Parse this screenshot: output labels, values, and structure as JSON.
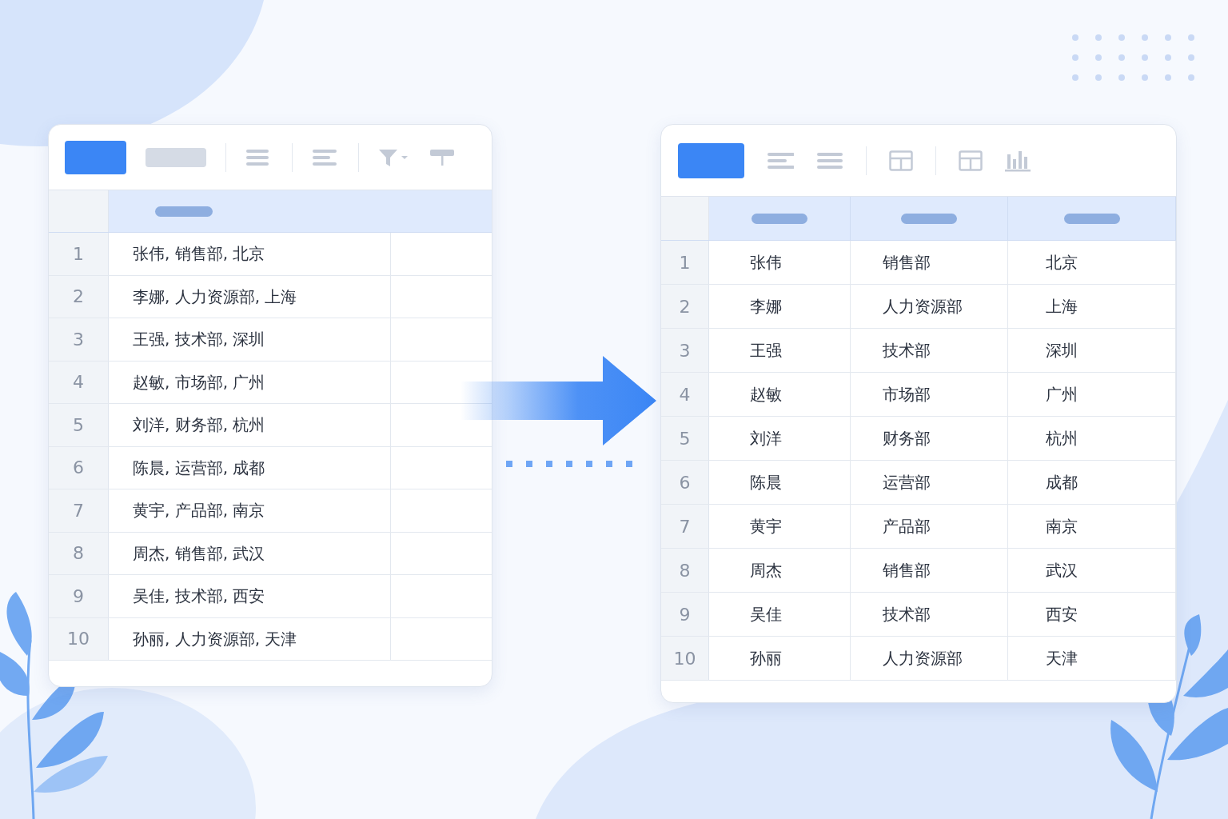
{
  "source_sheet": {
    "rows": [
      {
        "number": "1",
        "text": "张伟, 销售部, 北京"
      },
      {
        "number": "2",
        "text": "李娜, 人力资源部, 上海"
      },
      {
        "number": "3",
        "text": "王强, 技术部, 深圳"
      },
      {
        "number": "4",
        "text": "赵敏, 市场部, 广州"
      },
      {
        "number": "5",
        "text": "刘洋, 财务部, 杭州"
      },
      {
        "number": "6",
        "text": "陈晨, 运营部, 成都"
      },
      {
        "number": "7",
        "text": "黄宇, 产品部, 南京"
      },
      {
        "number": "8",
        "text": "周杰, 销售部, 武汉"
      },
      {
        "number": "9",
        "text": "吴佳, 技术部, 西安"
      },
      {
        "number": "10",
        "text": "孙丽, 人力资源部, 天津"
      }
    ]
  },
  "result_sheet": {
    "rows": [
      {
        "number": "1",
        "cells": [
          "张伟",
          "销售部",
          "北京"
        ]
      },
      {
        "number": "2",
        "cells": [
          "李娜",
          "人力资源部",
          "上海"
        ]
      },
      {
        "number": "3",
        "cells": [
          "王强",
          "技术部",
          "深圳"
        ]
      },
      {
        "number": "4",
        "cells": [
          "赵敏",
          "市场部",
          "广州"
        ]
      },
      {
        "number": "5",
        "cells": [
          "刘洋",
          "财务部",
          "杭州"
        ]
      },
      {
        "number": "6",
        "cells": [
          "陈晨",
          "运营部",
          "成都"
        ]
      },
      {
        "number": "7",
        "cells": [
          "黄宇",
          "产品部",
          "南京"
        ]
      },
      {
        "number": "8",
        "cells": [
          "周杰",
          "销售部",
          "武汉"
        ]
      },
      {
        "number": "9",
        "cells": [
          "吴佳",
          "技术部",
          "西安"
        ]
      },
      {
        "number": "10",
        "cells": [
          "孙丽",
          "人力资源部",
          "天津"
        ]
      }
    ]
  }
}
